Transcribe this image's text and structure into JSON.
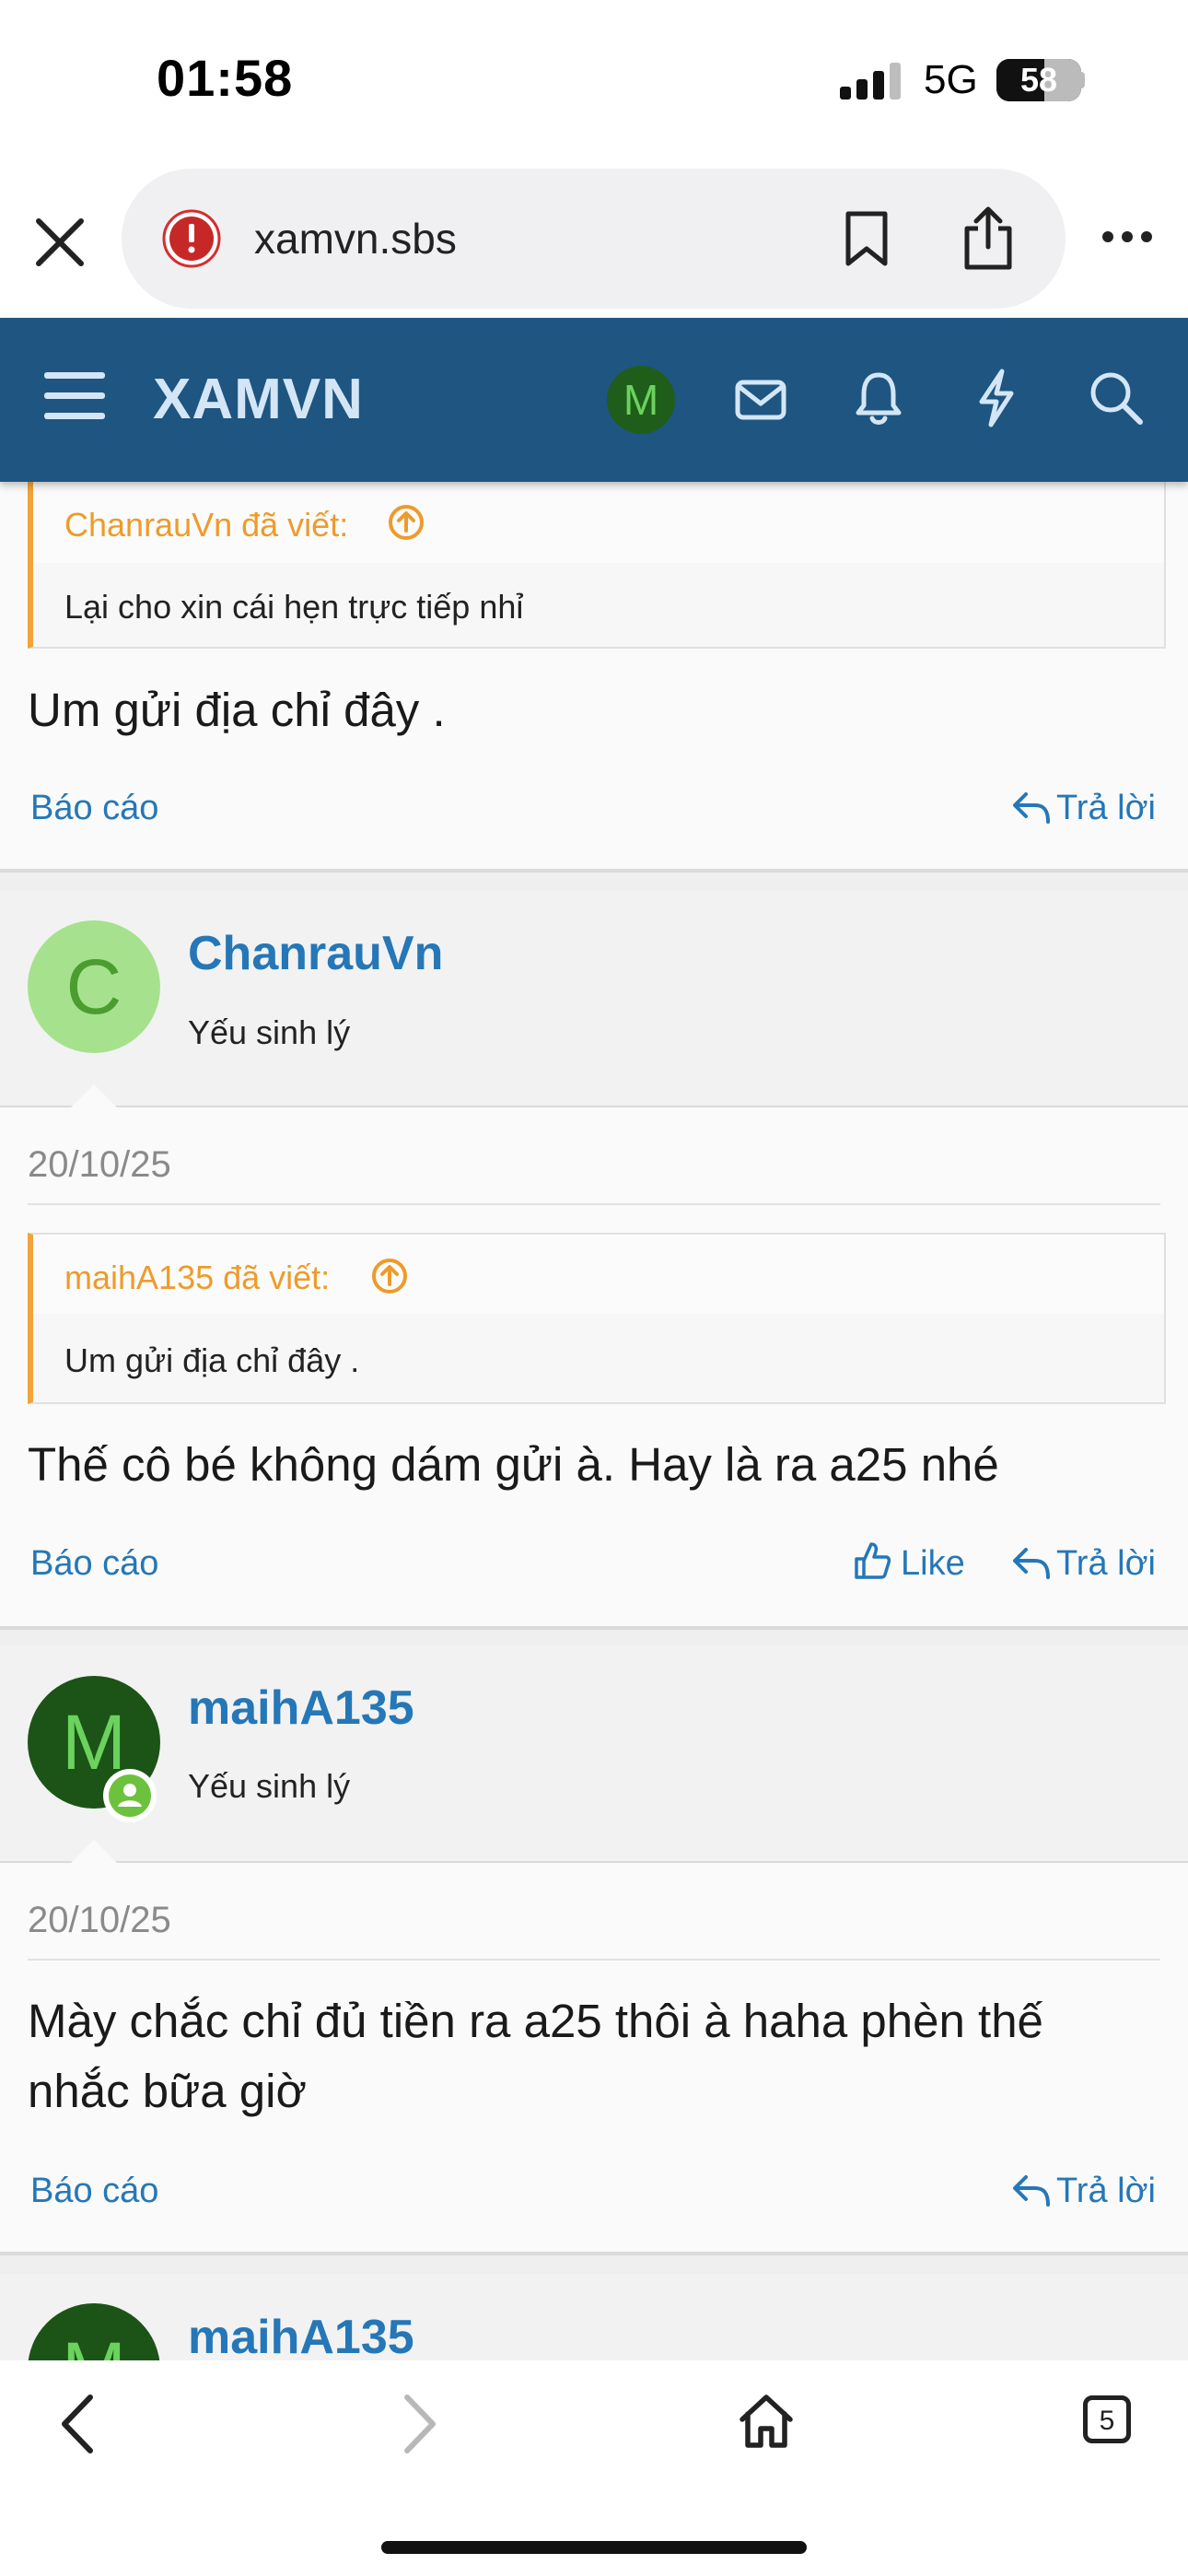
{
  "status_bar": {
    "time": "01:58",
    "network": "5G",
    "battery": "58"
  },
  "browser": {
    "url": "xamvn.sbs"
  },
  "site": {
    "logo": "XAMVN",
    "user_avatar_letter": "M"
  },
  "posts": [
    {
      "quote_author": "ChanrauVn đã viết:",
      "quote_text": "Lại cho xin cái hẹn trực tiếp nhỉ",
      "text": "Um gửi địa chỉ đây .",
      "report": "Báo cáo",
      "reply": "Trả lời"
    },
    {
      "username": "ChanrauVn",
      "user_title": "Yếu sinh lý",
      "avatar_letter": "C",
      "date": "20/10/25",
      "quote_author": "maihA135 đã viết:",
      "quote_text": "Um gửi địa chỉ đây .",
      "text": "Thế cô bé không dám gửi à. Hay là ra a25 nhé",
      "report": "Báo cáo",
      "like": "Like",
      "reply": "Trả lời"
    },
    {
      "username": "maihA135",
      "user_title": "Yếu sinh lý",
      "avatar_letter": "M",
      "date": "20/10/25",
      "text_line1": "Mày chắc chỉ đủ tiền ra a25 thôi à haha phèn thế",
      "text_line2": "nhắc bữa giờ",
      "report": "Báo cáo",
      "reply": "Trả lời"
    },
    {
      "username": "maihA135",
      "avatar_letter": "M"
    }
  ],
  "bottom_bar": {
    "tab_count": "5"
  },
  "colors": {
    "header": "#1e5581",
    "link": "#2577b7",
    "quote_accent": "#f2a33a"
  }
}
